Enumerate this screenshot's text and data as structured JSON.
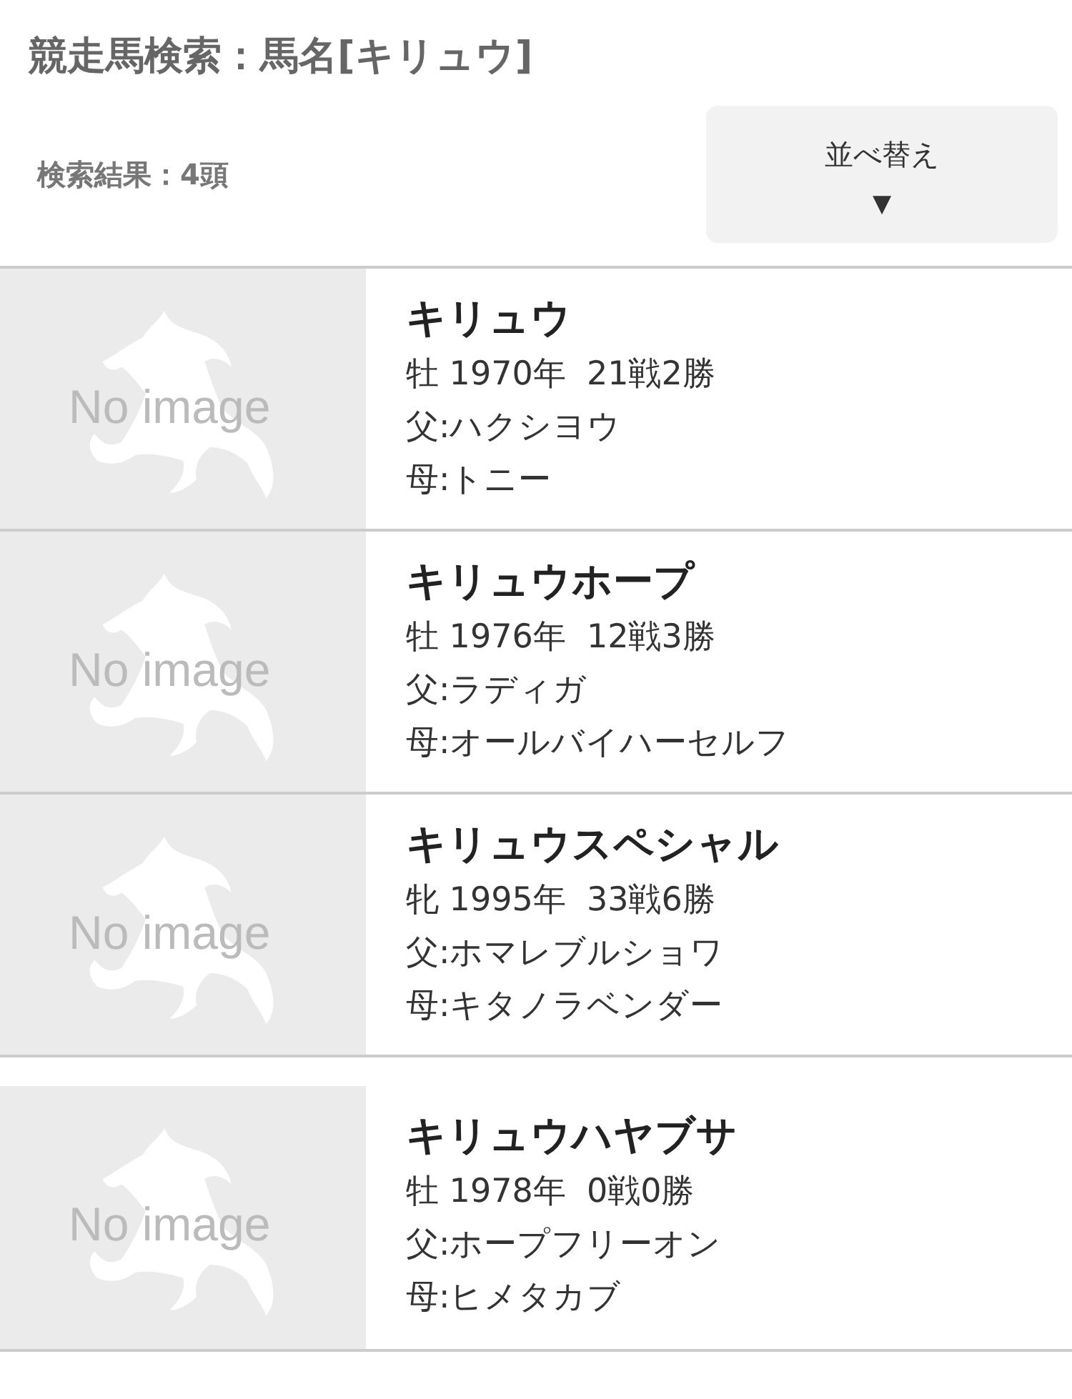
{
  "title": "競走馬検索：馬名[キリュウ]",
  "result_count": "検索結果：4頭",
  "sort_button": {
    "label": "並べ替え",
    "arrow": "▼"
  },
  "horses": [
    {
      "image_label": "No image",
      "name": "キリュウ",
      "profile": "牡 1970年  21戦2勝",
      "sire": "父:ハクシヨウ",
      "dam": "母:トニー"
    },
    {
      "image_label": "No image",
      "name": "キリュウホープ",
      "profile": "牡 1976年  12戦3勝",
      "sire": "父:ラディガ",
      "dam": "母:オールバイハーセルフ"
    },
    {
      "image_label": "No image",
      "name": "キリュウスペシャル",
      "profile": "牝 1995年  33戦6勝",
      "sire": "父:ホマレブルショワ",
      "dam": "母:キタノラベンダー"
    },
    {
      "image_label": "No image",
      "name": "キリュウハヤブサ",
      "profile": "牡 1978年  0戦0勝",
      "sire": "父:ホープフリーオン",
      "dam": "母:ヒメタカブ"
    }
  ]
}
